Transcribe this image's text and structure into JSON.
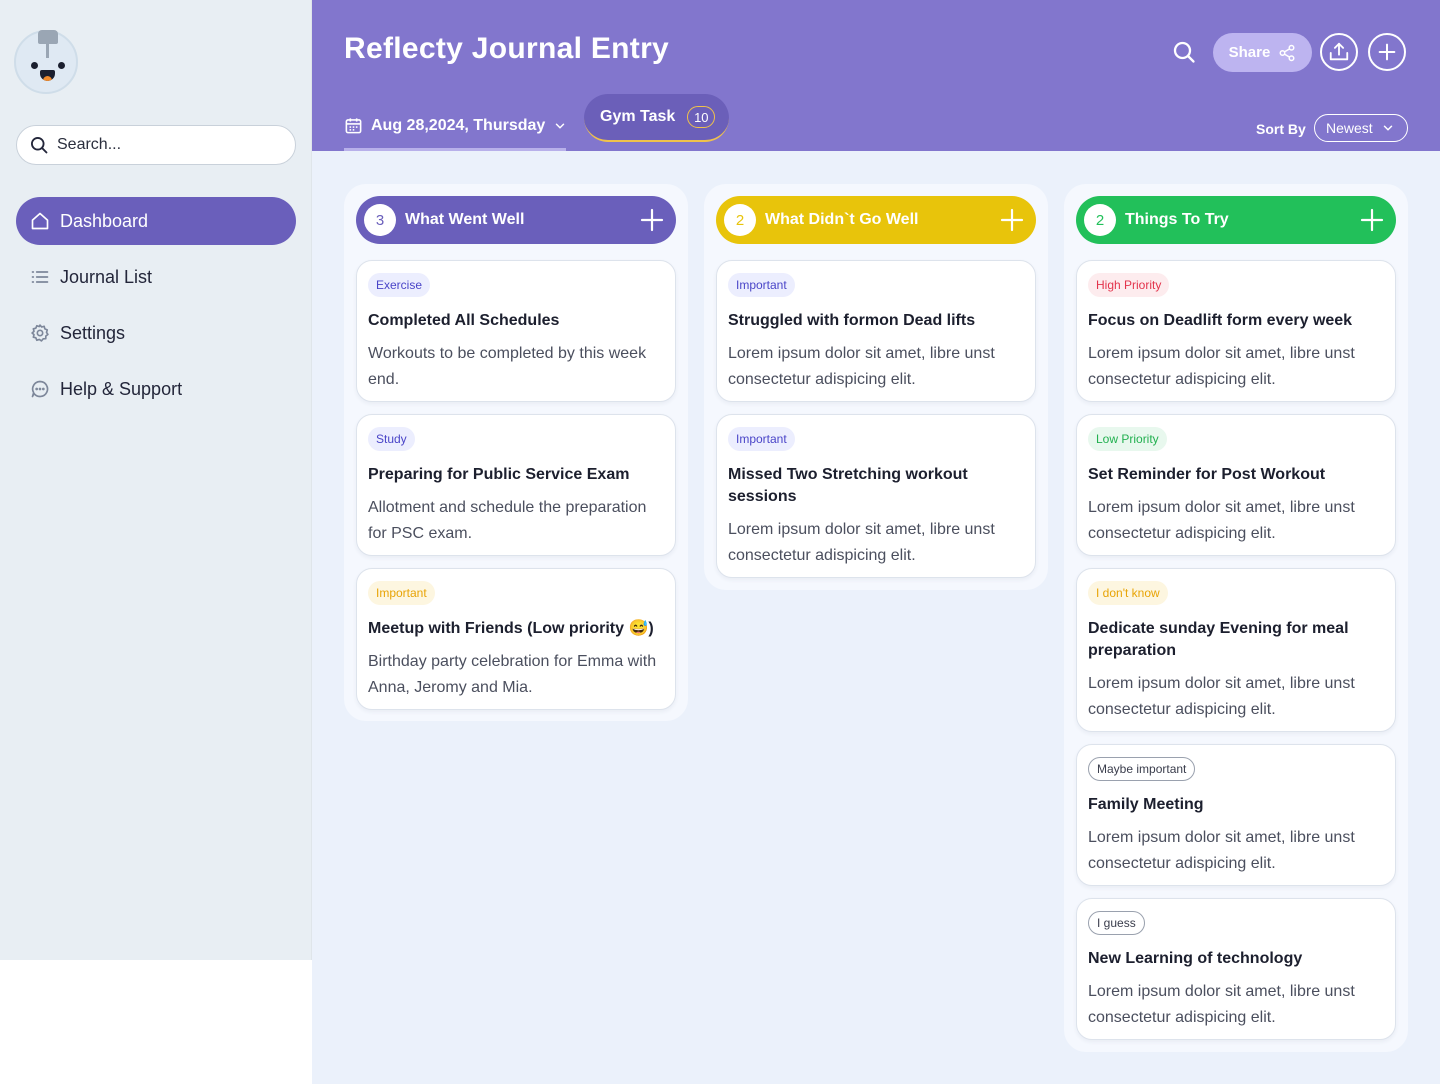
{
  "sidebar": {
    "search_placeholder": "Search...",
    "items": [
      {
        "label": "Dashboard",
        "icon": "home-icon",
        "active": true
      },
      {
        "label": "Journal List",
        "icon": "list-icon"
      },
      {
        "label": "Settings",
        "icon": "gear-icon"
      },
      {
        "label": "Help & Support",
        "icon": "chat-icon"
      }
    ]
  },
  "header": {
    "title": "Reflecty Journal Entry",
    "share_label": "Share",
    "date_label": "Aug 28,2024, Thursday",
    "tab_label": "Gym Task",
    "tab_count": "10",
    "sort_label": "Sort By",
    "sort_value": "Newest"
  },
  "columns": [
    {
      "title": "What Went Well",
      "count": "3",
      "color": "#6a5fbb",
      "cards": [
        {
          "tag": "Exercise",
          "title": "Completed All Schedules",
          "desc": "Workouts to be completed by this week end."
        },
        {
          "tag": "Study",
          "title": "Preparing for Public Service Exam",
          "desc": "Allotment and schedule the preparation for PSC exam."
        },
        {
          "tag": "Important",
          "title": "Meetup with Friends (Low priority 😅)",
          "desc": "Birthday party celebration for Emma with Anna, Jeromy and Mia."
        }
      ]
    },
    {
      "title": "What Didn`t Go Well",
      "count": "2",
      "color": "#e8c40b",
      "cards": [
        {
          "tag": "Important",
          "title": "Struggled with formon Dead lifts",
          "desc": "Lorem ipsum dolor sit amet, libre unst consectetur adispicing elit."
        },
        {
          "tag": "Important",
          "title": "Missed Two Stretching workout sessions",
          "desc": "Lorem ipsum dolor sit amet, libre unst consectetur adispicing elit."
        }
      ]
    },
    {
      "title": "Things To Try",
      "count": "2",
      "color": "#22c05a",
      "cards": [
        {
          "tag": "High Priority",
          "title": "Focus on Deadlift form  every week",
          "desc": "Lorem ipsum dolor sit amet, libre unst consectetur adispicing elit."
        },
        {
          "tag": "Low Priority",
          "title": "Set Reminder for Post Workout",
          "desc": "Lorem ipsum dolor sit amet, libre unst consectetur adispicing elit."
        },
        {
          "tag": "I don't know",
          "title": "Dedicate sunday Evening for meal preparation",
          "desc": "Lorem ipsum dolor sit amet, libre unst consectetur adispicing elit."
        },
        {
          "tag": "Maybe important",
          "title": "Family Meeting",
          "desc": "Lorem ipsum dolor sit amet, libre unst consectetur adispicing elit."
        },
        {
          "tag": "I guess",
          "title": "New Learning of technology",
          "desc": "Lorem ipsum dolor sit amet, libre unst consectetur adispicing elit."
        }
      ]
    }
  ],
  "colors": {
    "header_bg": "#8276cd",
    "accent": "#6a5fbb",
    "tag_exercise_bg": "#eceefe",
    "tag_exercise_text": "#4a45c8",
    "tag_important_bg": "#fdf6e0",
    "tag_important_text": "#e8a406",
    "tag_high_bg": "#fdecee",
    "tag_high_text": "#e3344c",
    "tag_low_bg": "#e8f8ee",
    "tag_low_text": "#22b050"
  }
}
